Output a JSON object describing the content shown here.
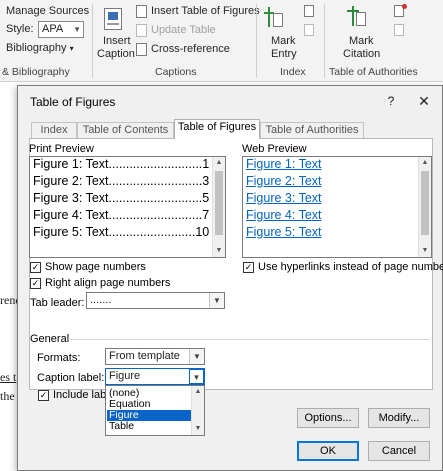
{
  "ribbon": {
    "manage_sources": "Manage Sources",
    "style_label": "Style:",
    "style_value": "APA",
    "bibliography": "Bibliography",
    "group_citations": "& Bibliography",
    "insert_caption_1": "Insert",
    "insert_caption_2": "Caption",
    "insert_table_of_figures": "Insert Table of Figures",
    "update_table": "Update Table",
    "cross_reference": "Cross-reference",
    "group_captions": "Captions",
    "mark_entry_1": "Mark",
    "mark_entry_2": "Entry",
    "group_index": "Index",
    "mark_citation_1": "Mark",
    "mark_citation_2": "Citation",
    "group_toa": "Table of Authorities"
  },
  "document": {
    "frag1": "renc",
    "frag2": "es t",
    "frag3": "the"
  },
  "dialog": {
    "title": "Table of Figures",
    "help": "?",
    "close": "✕",
    "tabs": [
      {
        "label": "Index"
      },
      {
        "label": "Table of Contents"
      },
      {
        "label": "Table of Figures"
      },
      {
        "label": "Table of Authorities"
      }
    ],
    "print_preview_label": "Print Preview",
    "print_preview_items": [
      "Figure 1: Text...........................1",
      "Figure 2: Text...........................3",
      "Figure 3: Text...........................5",
      "Figure 4: Text...........................7",
      "Figure 5: Text.........................10"
    ],
    "web_preview_label": "Web Preview",
    "web_preview_items": [
      "Figure 1: Text",
      "Figure 2: Text",
      "Figure 3: Text",
      "Figure 4: Text",
      "Figure 5: Text"
    ],
    "show_page_numbers": "Show page numbers",
    "right_align_page_numbers": "Right align page numbers",
    "use_hyperlinks": "Use hyperlinks instead of page numbers",
    "tab_leader_label": "Tab leader:",
    "tab_leader_value": ".......",
    "general_label": "General",
    "formats_label": "Formats:",
    "formats_value": "From template",
    "caption_label_label": "Caption label:",
    "caption_label_value": "Figure",
    "include_label": "Include label",
    "caption_options": [
      "(none)",
      "Equation",
      "Figure",
      "Table"
    ],
    "options_button": "Options...",
    "modify_button": "Modify...",
    "ok_button": "OK",
    "cancel_button": "Cancel"
  }
}
